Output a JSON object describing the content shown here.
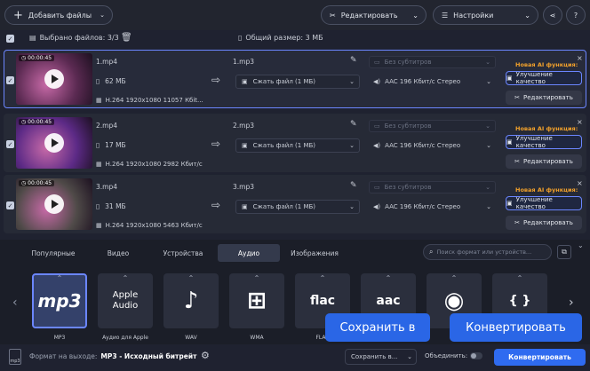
{
  "toolbar": {
    "add_files": "Добавить файлы",
    "edit": "Редактировать",
    "settings": "Настройки"
  },
  "selection": {
    "label": "Выбрано файлов: 3/3",
    "total_label": "Общий размер: 3 МБ"
  },
  "files": [
    {
      "duration": "00:00:45",
      "name": "1.mp4",
      "size": "62 МБ",
      "info": "H.264 1920x1080 11057 Кбit...",
      "out_name": "1.mp3",
      "compress": "Сжать файл (1 МБ)",
      "subtitles": "Без субтитров",
      "audio": "AAC 196 Кбит/с Стерео",
      "ai_label": "Новая AI функция:",
      "enhance": "Улучшение качество",
      "edit": "Редактировать",
      "thumb_color": "#5b2a52"
    },
    {
      "duration": "00:00:45",
      "name": "2.mp4",
      "size": "17 МБ",
      "info": "H.264 1920x1080 2982 Кбит/с",
      "out_name": "2.mp3",
      "compress": "Сжать файл (1 МБ)",
      "subtitles": "Без субтитров",
      "audio": "AAC 196 Кбит/с Стерео",
      "ai_label": "Новая AI функция:",
      "enhance": "Улучшение качество",
      "edit": "Редактировать",
      "thumb_color": "#5c2a86"
    },
    {
      "duration": "00:00:45",
      "name": "3.mp4",
      "size": "31 МБ",
      "info": "H.264 1920x1080 5463 Кбит/с",
      "out_name": "3.mp3",
      "compress": "Сжать файл (1 МБ)",
      "subtitles": "Без субтитров",
      "audio": "AAC 196 Кбит/с Стерео",
      "ai_label": "Новая AI функция:",
      "enhance": "Улучшение качество",
      "edit": "Редактировать",
      "thumb_color": "#4f4a48"
    }
  ],
  "tabs": [
    "Популярные",
    "Видео",
    "Устройства",
    "Аудио",
    "Изображения"
  ],
  "active_tab": "Аудио",
  "search": {
    "placeholder": "Поиск формат или устройств..."
  },
  "formats": [
    {
      "icon": "mp3",
      "label": "MP3"
    },
    {
      "icon": "Apple Audio",
      "label": "Аудио для Apple"
    },
    {
      "icon": "♪",
      "label": "WAV"
    },
    {
      "icon": "⊞",
      "label": "WMA"
    },
    {
      "icon": "flac",
      "label": "FLAC"
    },
    {
      "icon": "aac",
      "label": ""
    },
    {
      "icon": "◉",
      "label": ""
    },
    {
      "icon": "{ }",
      "label": ""
    }
  ],
  "bottom": {
    "format_label": "Формат на выходе:",
    "format_value": "MP3 - Исходный битрейт",
    "save_in": "Сохранить в...",
    "merge": "Объединить:",
    "convert": "Конвертировать"
  },
  "tooltips": {
    "save_in": "Сохранить в",
    "convert": "Конвертировать"
  }
}
